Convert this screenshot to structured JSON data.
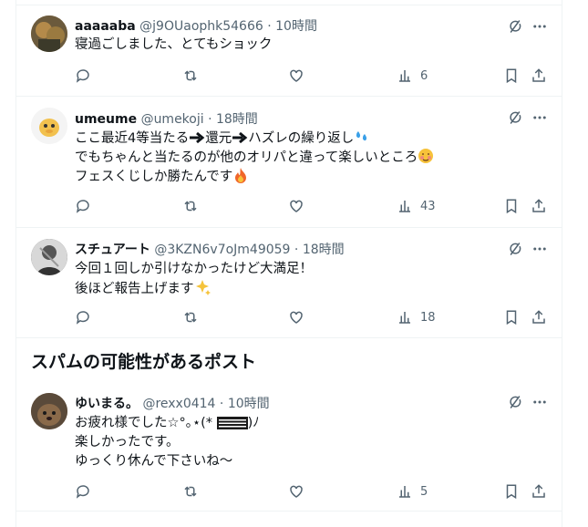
{
  "section_title": "スパムの可能性があるポスト",
  "posts": [
    {
      "name": "aaaaaba",
      "handle": "@j9OUaophk54666",
      "time": "· 10時間",
      "lines": [
        "寝過ごしました、とてもショック"
      ],
      "views": "6"
    },
    {
      "name": "umeume",
      "handle": "@umekoji",
      "time": "· 18時間",
      "lines": [
        "ここ最近4等当たる",
        "還元",
        "ハズレの繰り返し",
        "でもちゃんと当たるのが他のオリパと違って楽しいところ",
        "フェスくじしか勝たんです"
      ],
      "views": "43"
    },
    {
      "name": "スチュアート",
      "handle": "@3KZN6v7oJm49059",
      "time": "· 18時間",
      "lines": [
        "今回１回しか引けなかったけど大満足！",
        "後ほど報告上げます"
      ],
      "views": "18"
    },
    {
      "name": "ゆいまる。",
      "handle": "@rexx0414",
      "time": "· 10時間",
      "lines": [
        "お疲れ様でした☆°｡⋆(* ",
        ")ﾉ",
        "楽しかったです。",
        "ゆっくり休んで下さいね〜"
      ],
      "views": "5"
    }
  ],
  "colors": {
    "text": "#0f1419",
    "muted": "#536471",
    "border": "#eff3f4"
  },
  "icons": [
    "reply-icon",
    "repost-icon",
    "like-icon",
    "views-icon",
    "bookmark-icon",
    "share-icon",
    "grok-icon",
    "more-icon"
  ]
}
